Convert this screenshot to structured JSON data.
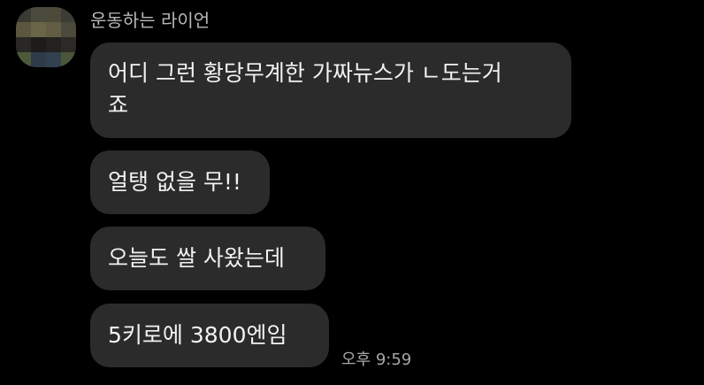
{
  "sender": {
    "name": "운동하는 라이언"
  },
  "messages": [
    {
      "lines": [
        "어디 그런 황당무계한 가짜뉴스가 ㄴ도는거",
        "죠"
      ]
    },
    {
      "text": "얼탱 없을 무!!"
    },
    {
      "text": "오늘도 쌀 사왔는데"
    },
    {
      "text": "5키로에 3800엔임"
    }
  ],
  "timestamp": "오후 9:59",
  "colors": {
    "background": "#000000",
    "bubble": "#2b2b2b",
    "message_text": "#f2f2f2",
    "sender_name": "#b9b9b9",
    "timestamp": "#a6a6a6"
  },
  "avatar": {
    "pixelated": true
  }
}
